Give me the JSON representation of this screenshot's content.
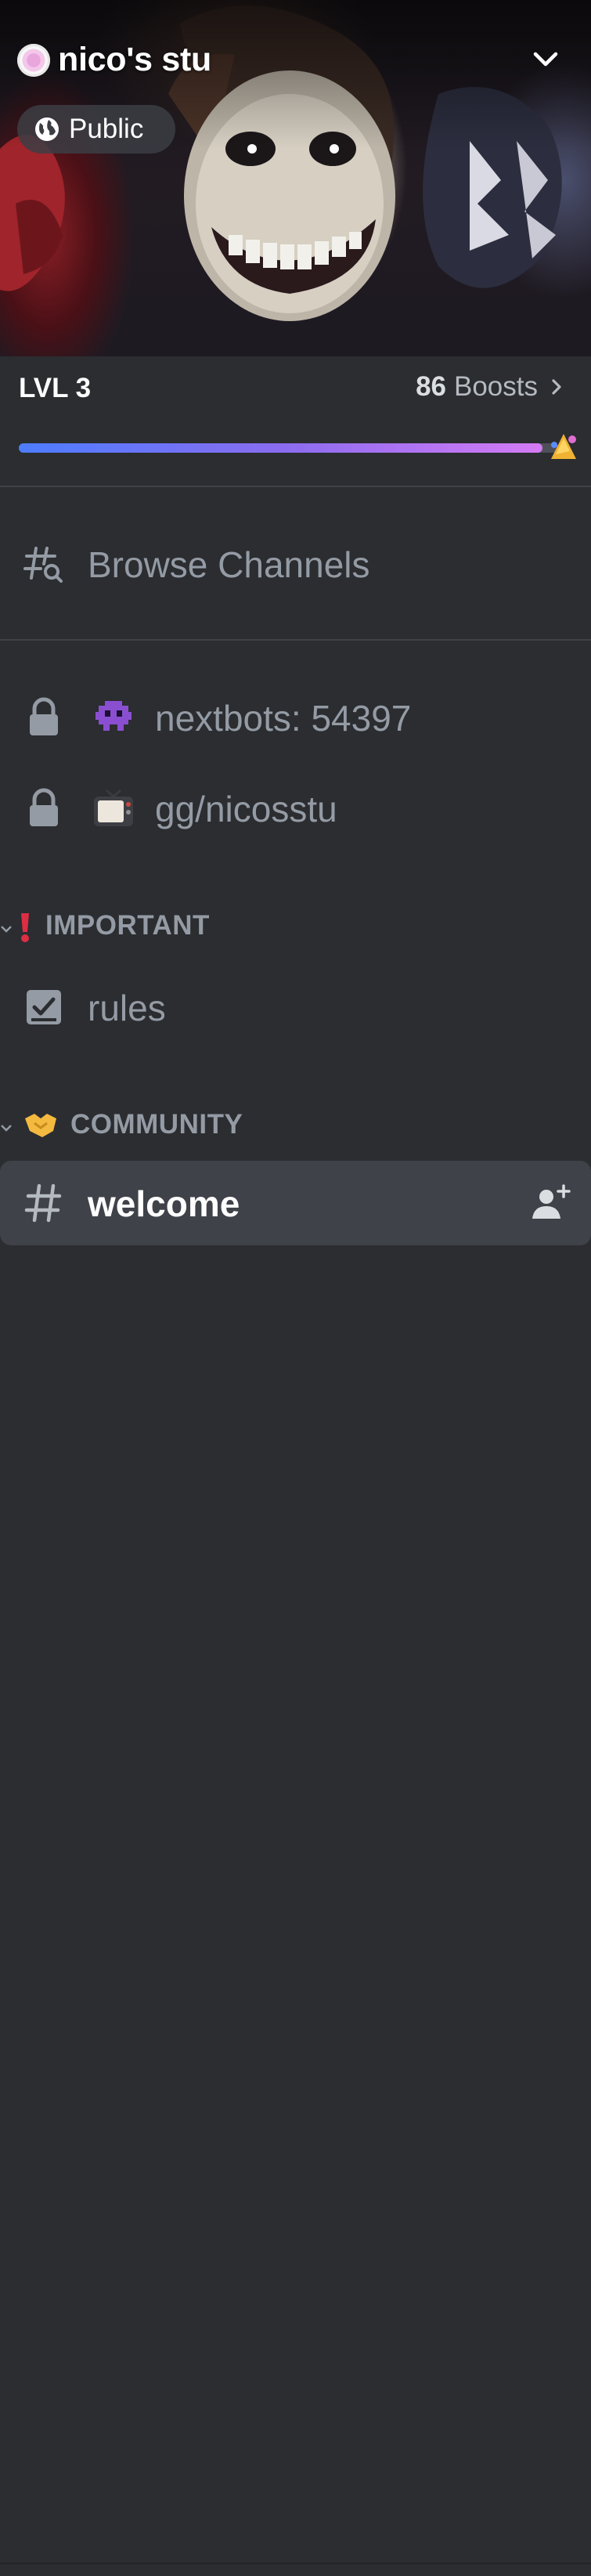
{
  "server": {
    "name": "nico's stu",
    "visibility": "Public"
  },
  "boost": {
    "level": "LVL 3",
    "count": "86",
    "label": "Boosts",
    "progress": 0.97
  },
  "nav": {
    "browse_channels": "Browse Channels"
  },
  "channels": [
    {
      "name": "nextbots: 54397",
      "locked": true,
      "emoji": "alien-monster"
    },
    {
      "name": "gg/nicosstu",
      "locked": true,
      "emoji": "television"
    }
  ],
  "categories": [
    {
      "name": "IMPORTANT",
      "emoji": "exclamation",
      "channels": [
        {
          "name": "rules",
          "icon": "rules-icon"
        }
      ]
    },
    {
      "name": "COMMUNITY",
      "emoji": "handshake",
      "channels": [
        {
          "name": "welcome",
          "icon": "hash-icon",
          "selected": true
        }
      ]
    }
  ],
  "colors": {
    "sidebar_bg": "#2b2d31",
    "selected_bg": "#404249",
    "text_muted": "#949ba4",
    "accent_gradient": [
      "#4d7dff",
      "#d57bf4"
    ]
  }
}
